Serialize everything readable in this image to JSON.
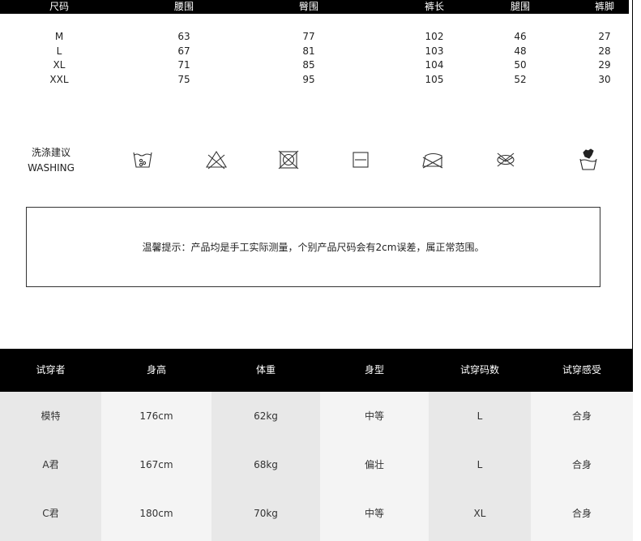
{
  "size_chart": {
    "headers": [
      "尺码",
      "腰围",
      "臀围",
      "裤长",
      "腿围",
      "裤脚"
    ],
    "rows": [
      [
        "M",
        "63",
        "77",
        "102",
        "46",
        "27"
      ],
      [
        "L",
        "67",
        "81",
        "103",
        "48",
        "28"
      ],
      [
        "XL",
        "71",
        "85",
        "104",
        "50",
        "29"
      ],
      [
        "XXL",
        "75",
        "95",
        "105",
        "52",
        "30"
      ]
    ]
  },
  "washing": {
    "label_cn": "洗涤建议",
    "label_en": "WASHING",
    "icons": [
      "hand-wash-icon",
      "do-not-bleach-icon",
      "do-not-tumble-dry-icon",
      "dry-flat-icon",
      "do-not-iron-icon",
      "do-not-dry-clean-icon",
      "hand-wash-glove-icon"
    ]
  },
  "tip": {
    "text": "温馨提示：产品均是手工实际测量，个别产品尺码会有2cm误差，属正常范围。"
  },
  "fitting": {
    "headers": [
      "试穿者",
      "身高",
      "体重",
      "身型",
      "试穿码数",
      "试穿感受"
    ],
    "rows": [
      [
        "模特",
        "176cm",
        "62kg",
        "中等",
        "L",
        "合身"
      ],
      [
        "A君",
        "167cm",
        "68kg",
        "偏壮",
        "L",
        "合身"
      ],
      [
        "C君",
        "180cm",
        "70kg",
        "中等",
        "XL",
        "合身"
      ]
    ],
    "column_colors": [
      "#e8e8e8",
      "#f4f4f4",
      "#e8e8e8",
      "#f4f4f4",
      "#e8e8e8",
      "#f4f4f4"
    ]
  }
}
